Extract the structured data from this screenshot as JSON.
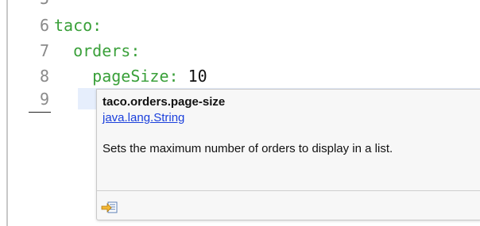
{
  "editor": {
    "lines": [
      {
        "number": "6",
        "key": "taco:",
        "value": ""
      },
      {
        "number": "7",
        "key": "  orders:",
        "value": ""
      },
      {
        "number": "8",
        "key": "    pageSize:",
        "value": " 10"
      },
      {
        "number": "9",
        "key": "",
        "value": ""
      }
    ]
  },
  "popup": {
    "title": "taco.orders.page-size",
    "type_link": "java.lang.String",
    "description": "Sets the maximum number of orders to display in a list.",
    "footer_icon": "open-declaration-icon"
  },
  "colors": {
    "key_green": "#3aa03a",
    "line_number_gray": "#8a8a8a",
    "link_blue": "#1a3fdc",
    "current_line_highlight": "#e6eefc"
  }
}
